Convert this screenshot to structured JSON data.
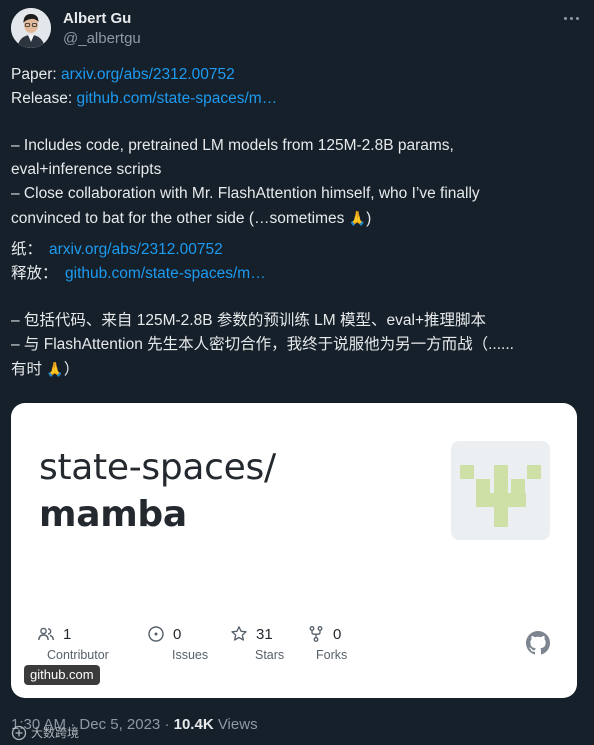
{
  "author": {
    "name": "Albert Gu",
    "handle": "@_albertgu"
  },
  "icons": {
    "more": "more-icon",
    "contributors": "people-icon",
    "issues": "issue-icon",
    "stars": "star-icon",
    "forks": "fork-icon",
    "github": "github-logo-icon"
  },
  "tweet": {
    "paper_label": "Paper: ",
    "paper_link": "arxiv.org/abs/2312.00752",
    "release_label": "Release: ",
    "release_link": "github.com/state-spaces/m…",
    "bullet1_line1": "– Includes code, pretrained LM models from 125M-2.8B params,",
    "bullet1_line2": "eval+inference scripts",
    "bullet2_line1": "– Close collaboration with Mr. FlashAttention himself, who I’ve finally",
    "bullet2_line2": "convinced to bat for the other side (…sometimes ",
    "bullet2_line2_end": ")",
    "cn_paper_label": "纸：",
    "cn_paper_link": "arxiv.org/abs/2312.00752",
    "cn_release_label": "释放：",
    "cn_release_link": "github.com/state-spaces/m…",
    "cn_bullet1": "– 包括代码、来自 125M-2.8B 参数的预训练 LM 模型、eval+推理脚本",
    "cn_bullet2_line1": "– 与 FlashAttention 先生本人密切合作，我终于说服他为另一方而战（......",
    "cn_bullet2_line2": "有时 ",
    "cn_bullet2_line2_end": "）",
    "emoji": "🙏"
  },
  "card": {
    "owner": "state-spaces/",
    "repo": "mamba",
    "domain": "github.com",
    "stats": [
      {
        "value": "1",
        "label": "Contributor"
      },
      {
        "value": "0",
        "label": "Issues"
      },
      {
        "value": "31",
        "label": "Stars"
      },
      {
        "value": "0",
        "label": "Forks"
      }
    ],
    "logo_color": "#cfe0a6"
  },
  "footer": {
    "time": "1:30 AM",
    "sep": " · ",
    "date": "Dec 5, 2023",
    "views_count": "10.4K",
    "views_label": " Views"
  },
  "watermark": {
    "text": "大数跨境"
  },
  "colors": {
    "background": "#15202b",
    "link": "#1d9bf0",
    "text": "#e7e9ea",
    "muted": "#8b98a5"
  }
}
